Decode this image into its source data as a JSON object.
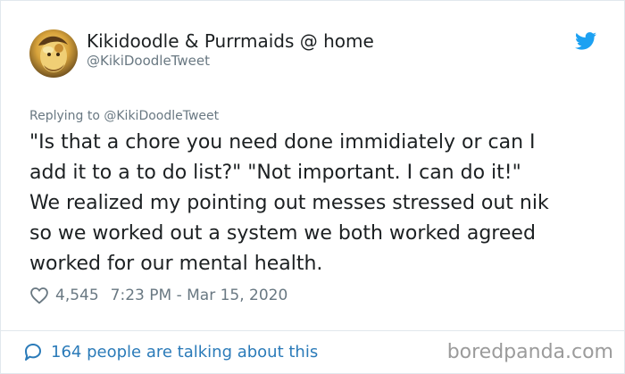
{
  "author": {
    "name": "Kikidoodle & Purrmaids @ home",
    "handle": "@KikiDoodleTweet"
  },
  "reply_to": "Replying to @KikiDoodleTweet",
  "tweet": {
    "text": "\"Is that a chore you need done immidiately or can I\nadd it to a to do list?\" \"Not important. I can do it!\"\nWe realized my pointing out messes stressed out nik\nso we worked out a system we both worked agreed\nworked for our mental health."
  },
  "meta": {
    "likes": "4,545",
    "timestamp": "7:23 PM - Mar 15, 2020"
  },
  "conversation": {
    "label": "164 people are talking about this"
  },
  "watermark": "boredpanda.com",
  "icons": {
    "brand": "twitter-bird-icon",
    "like": "heart-icon",
    "conversation": "speech-bubble-icon"
  },
  "colors": {
    "twitter_blue": "#1da1f2",
    "link": "#2b7bb9",
    "muted": "#697882",
    "text": "#1c2022",
    "border": "#e1e8ed",
    "watermark": "#9b9b9b"
  }
}
